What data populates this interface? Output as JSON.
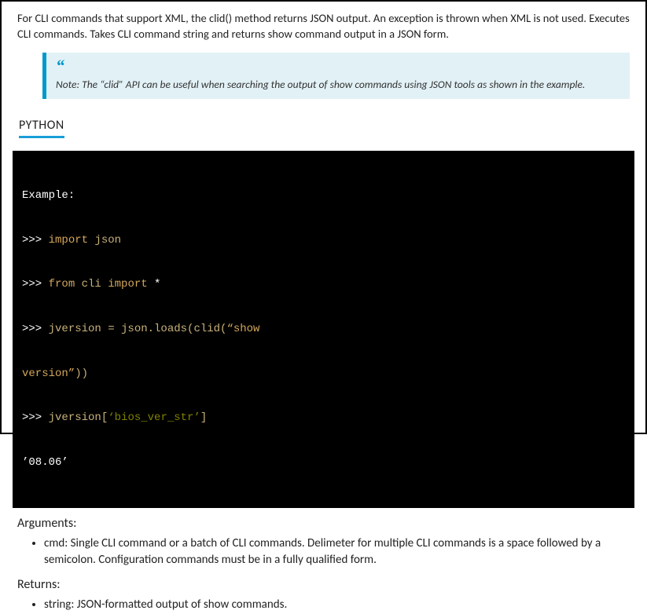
{
  "intro": "For CLI commands that support XML, the clid() method returns JSON output. An exception is thrown when XML  is not used. Executes CLI commands. Takes CLI command string and returns show command output in a JSON form.",
  "note": {
    "quote": "“",
    "text": "Note: The “clid” API can be useful when searching the output of show  commands using JSON tools as shown in the example."
  },
  "lang_label": "PYTHON",
  "code": {
    "line1": "Example:",
    "l2a": ">>> ",
    "l2b": "import",
    "l2c": " json",
    "l3a": ">>> ",
    "l3b": "from",
    "l3c": " cli ",
    "l3d": "import",
    "l3e": " *",
    "l4a": ">>> ",
    "l4b": "jversion = json.loads(clid(",
    "l4c": "“show",
    "l5a": "version”",
    "l5b": "))",
    "l6a": ">>> ",
    "l6b": "jversion[",
    "l6c": "‘bios_ver_str’",
    "l6d": "]",
    "l7": "’08.06’"
  },
  "arguments": {
    "heading": "Arguments:",
    "item1": "cmd: Single CLI command or a batch of CLI commands. Delimeter for multiple CLI commands is a space followed by a semicolon. Configuration commands must be in a fully qualified form."
  },
  "returns": {
    "heading": "Returns:",
    "item1": "string: JSON-formatted output of show commands."
  }
}
